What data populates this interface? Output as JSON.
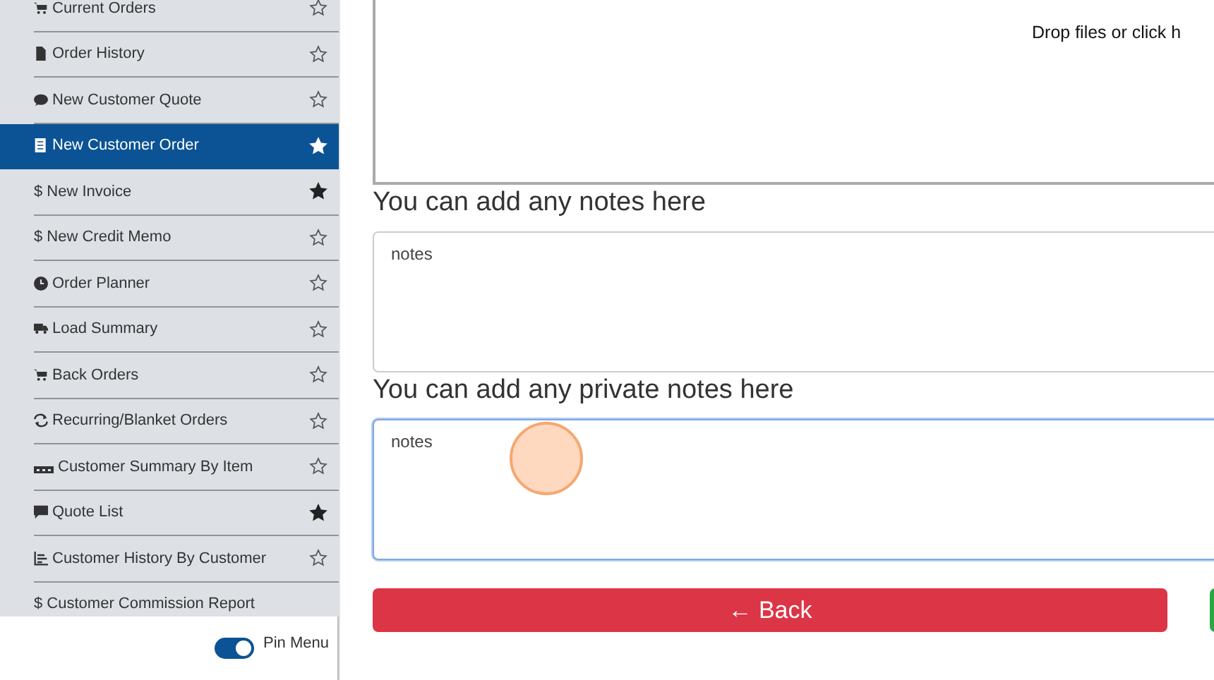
{
  "sidebar": {
    "items": [
      {
        "label": "Current Orders",
        "selected": false,
        "starred": false
      },
      {
        "label": "Order History",
        "selected": false,
        "starred": false
      },
      {
        "label": "New Customer Quote",
        "selected": false,
        "starred": false
      },
      {
        "label": "New Customer Order",
        "selected": true,
        "starred": true
      },
      {
        "label": "$ New Invoice",
        "selected": false,
        "starred": true
      },
      {
        "label": "$ New Credit Memo",
        "selected": false,
        "starred": false
      },
      {
        "label": "Order Planner",
        "selected": false,
        "starred": false
      },
      {
        "label": "Load Summary",
        "selected": false,
        "starred": false
      },
      {
        "label": "Back Orders",
        "selected": false,
        "starred": false
      },
      {
        "label": "Recurring/Blanket Orders",
        "selected": false,
        "starred": false
      },
      {
        "label": "Customer Summary By Item",
        "selected": false,
        "starred": false
      },
      {
        "label": "Quote List",
        "selected": false,
        "starred": true
      },
      {
        "label": "Customer History By Customer",
        "selected": false,
        "starred": false
      },
      {
        "label": "$ Customer Commission Report",
        "selected": false
      }
    ],
    "pin_menu": {
      "label": "Pin Menu",
      "on": true
    }
  },
  "dropzone": {
    "text": "Drop files or click h"
  },
  "notes": {
    "label": "You can add any notes here",
    "value": "notes",
    "focused": false
  },
  "private_notes": {
    "label": "You can add any private notes here",
    "value": "notes",
    "focused": true
  },
  "back_button": {
    "label": "← Back"
  }
}
